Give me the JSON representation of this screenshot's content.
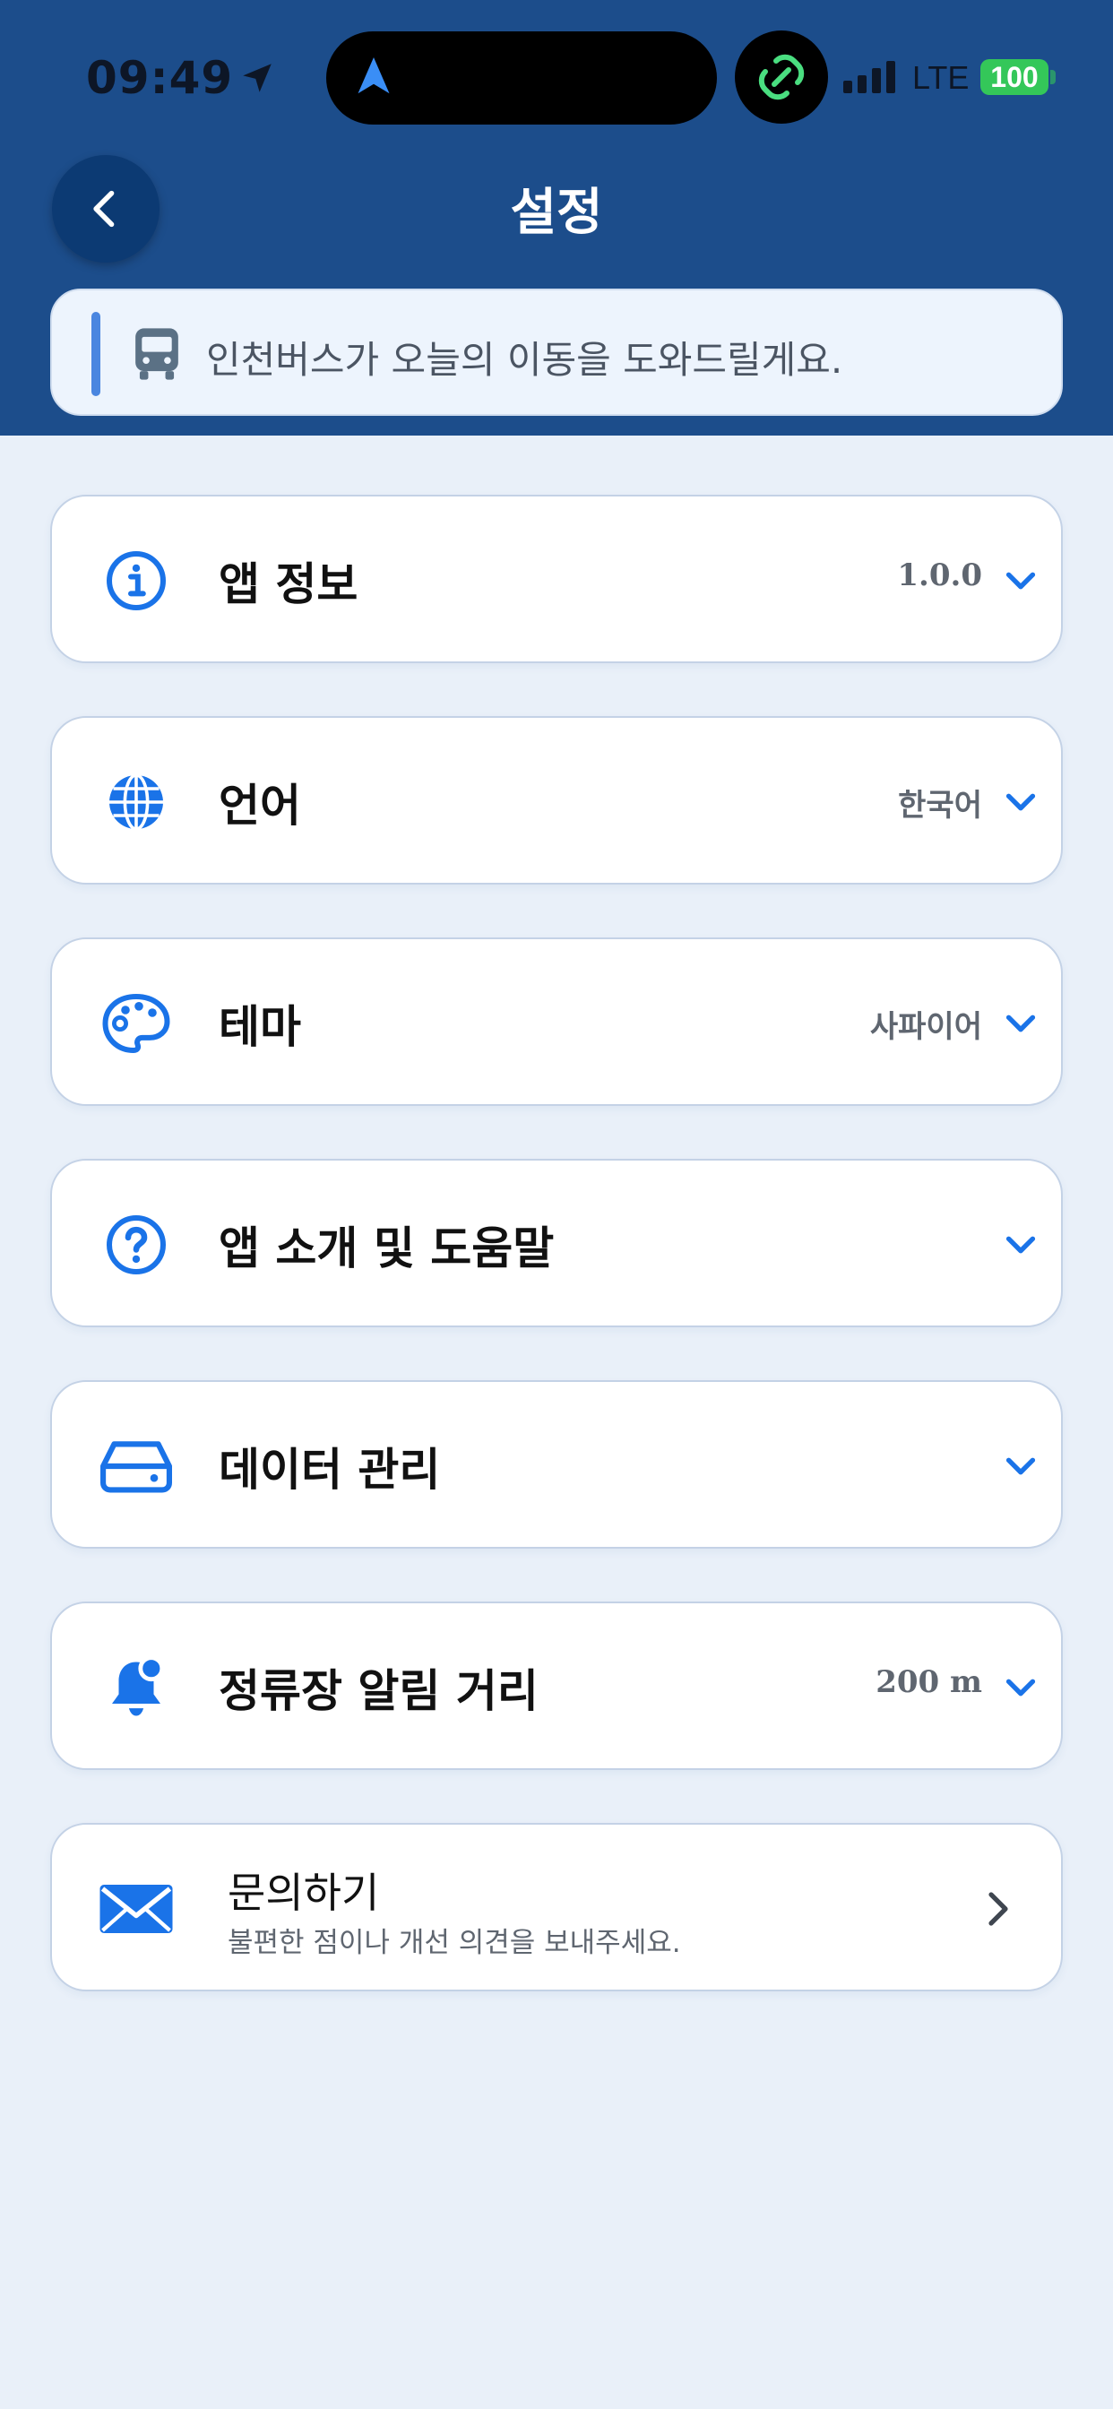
{
  "status_bar": {
    "time": "09:49",
    "network": "LTE",
    "battery": "100"
  },
  "header": {
    "title": "설정",
    "banner_text": "인천버스가 오늘의 이동을 도와드릴게요."
  },
  "settings": [
    {
      "id": "app-info",
      "icon": "info-icon",
      "label": "앱 정보",
      "value": "1.0.0"
    },
    {
      "id": "language",
      "icon": "globe-icon",
      "label": "언어",
      "value": "한국어"
    },
    {
      "id": "theme",
      "icon": "palette-icon",
      "label": "테마",
      "value": "사파이어"
    },
    {
      "id": "help",
      "icon": "question-icon",
      "label": "앱 소개 및 도움말",
      "value": ""
    },
    {
      "id": "data",
      "icon": "drive-icon",
      "label": "데이터 관리",
      "value": ""
    },
    {
      "id": "stop-alert",
      "icon": "bell-icon",
      "label": "정류장 알림 거리",
      "value": "200 m"
    }
  ],
  "contact": {
    "title": "문의하기",
    "subtitle": "불편한 점이나 개선 의견을 보내주세요."
  },
  "colors": {
    "header_bg": "#1c4d8b",
    "accent": "#1a73e8",
    "page_bg": "#e9f0f9"
  }
}
